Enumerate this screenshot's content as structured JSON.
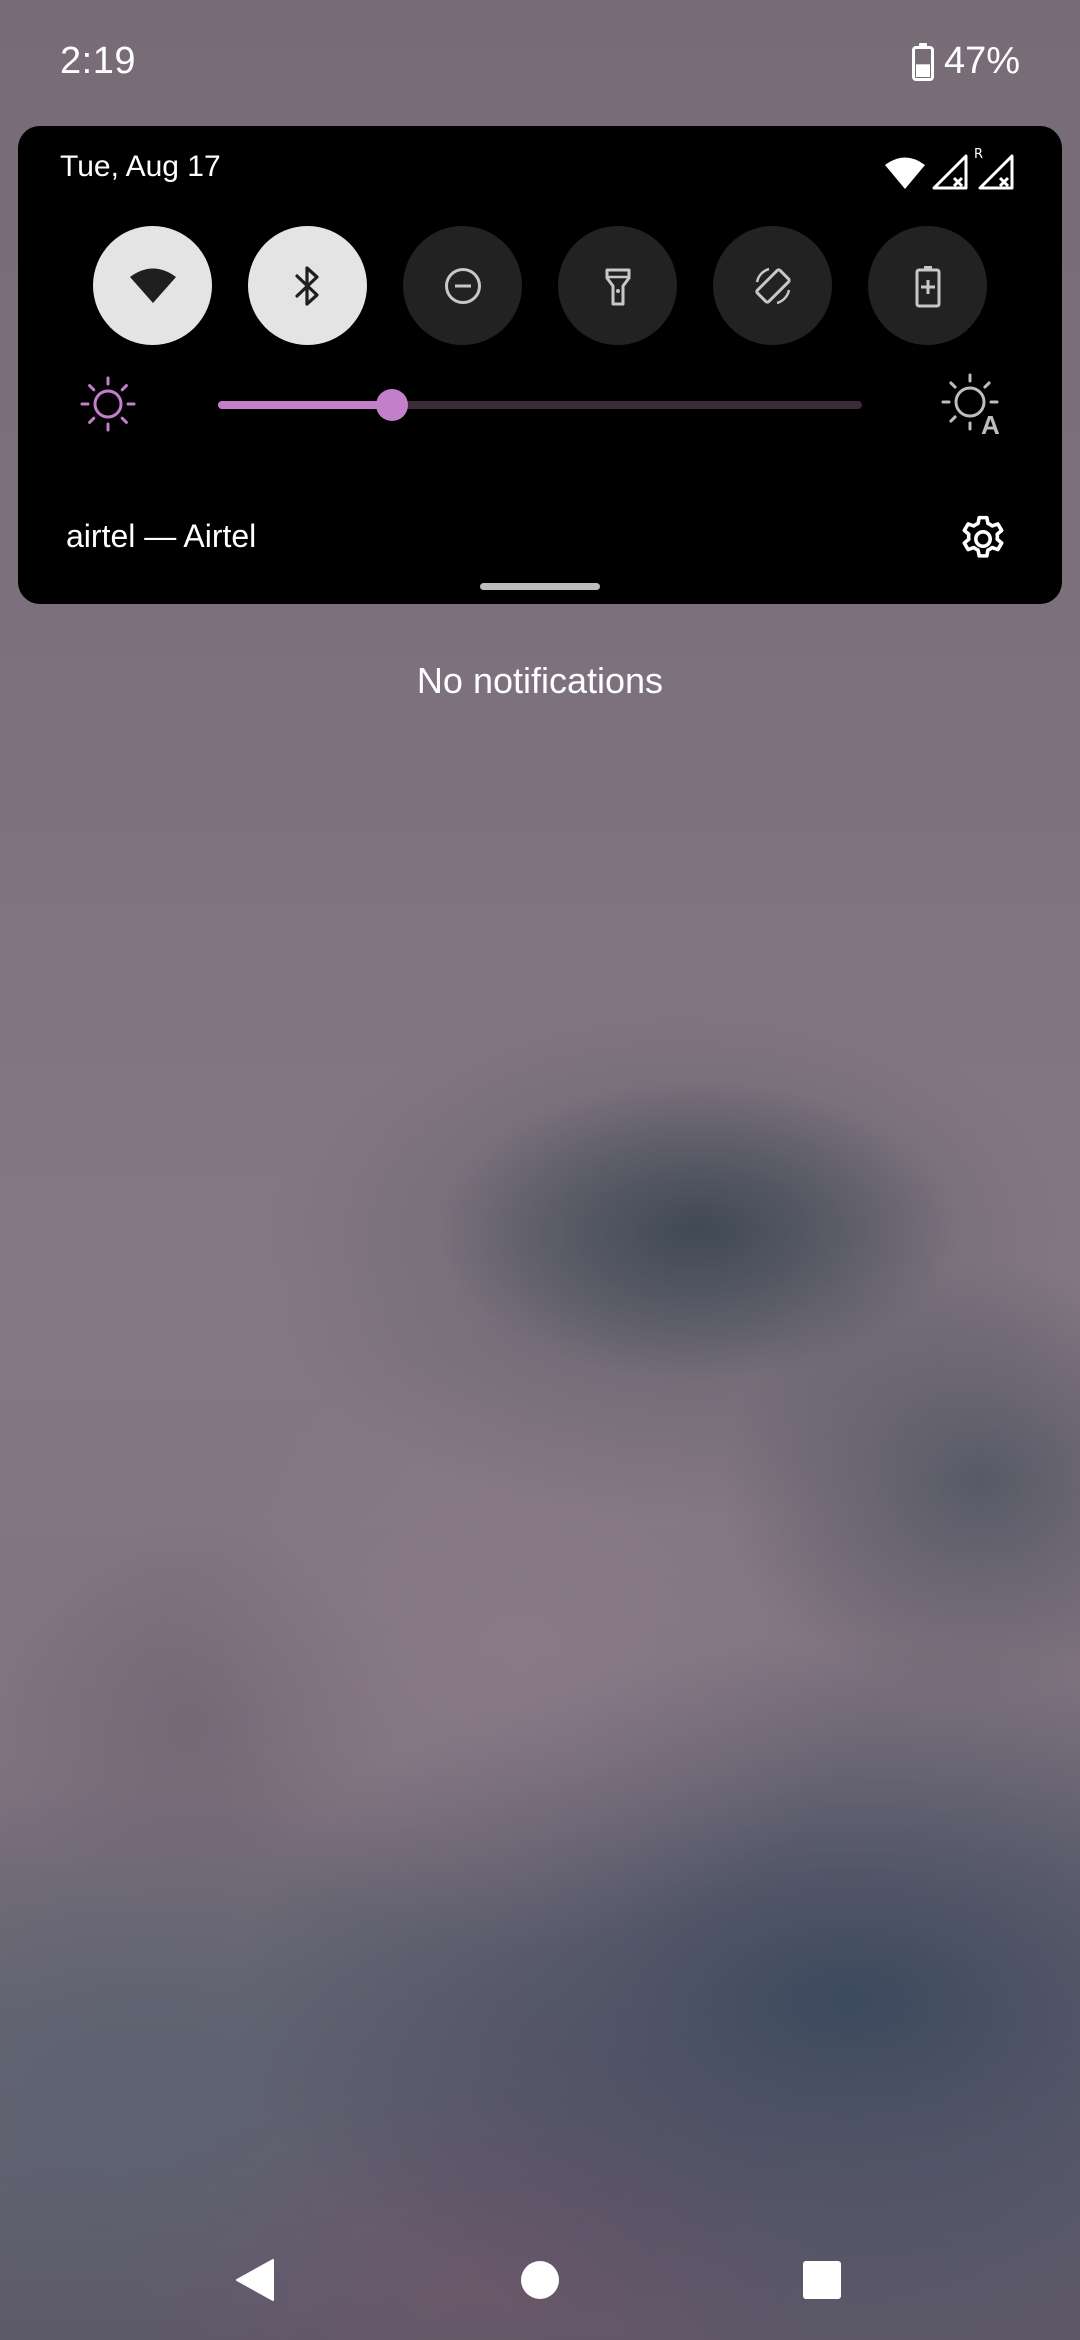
{
  "status_bar": {
    "time": "2:19",
    "battery_percent": "47%",
    "battery_level": 0.47
  },
  "quick_settings": {
    "date": "Tue, Aug 17",
    "roaming_label": "R",
    "tiles": [
      {
        "name": "wifi",
        "icon": "wifi-icon",
        "active": true
      },
      {
        "name": "bluetooth",
        "icon": "bluetooth-icon",
        "active": true
      },
      {
        "name": "do-not-disturb",
        "icon": "do-not-disturb-icon",
        "active": false
      },
      {
        "name": "flashlight",
        "icon": "flashlight-icon",
        "active": false
      },
      {
        "name": "auto-rotate",
        "icon": "auto-rotate-icon",
        "active": false
      },
      {
        "name": "battery-saver",
        "icon": "battery-saver-icon",
        "active": false
      }
    ],
    "brightness_level": 0.27,
    "brightness_auto_label": "A",
    "carrier": "airtel — Airtel",
    "accent_color": "#c47fca"
  },
  "notifications": {
    "empty_text": "No notifications"
  },
  "nav_bar": {
    "buttons": [
      "back",
      "home",
      "recents"
    ]
  }
}
